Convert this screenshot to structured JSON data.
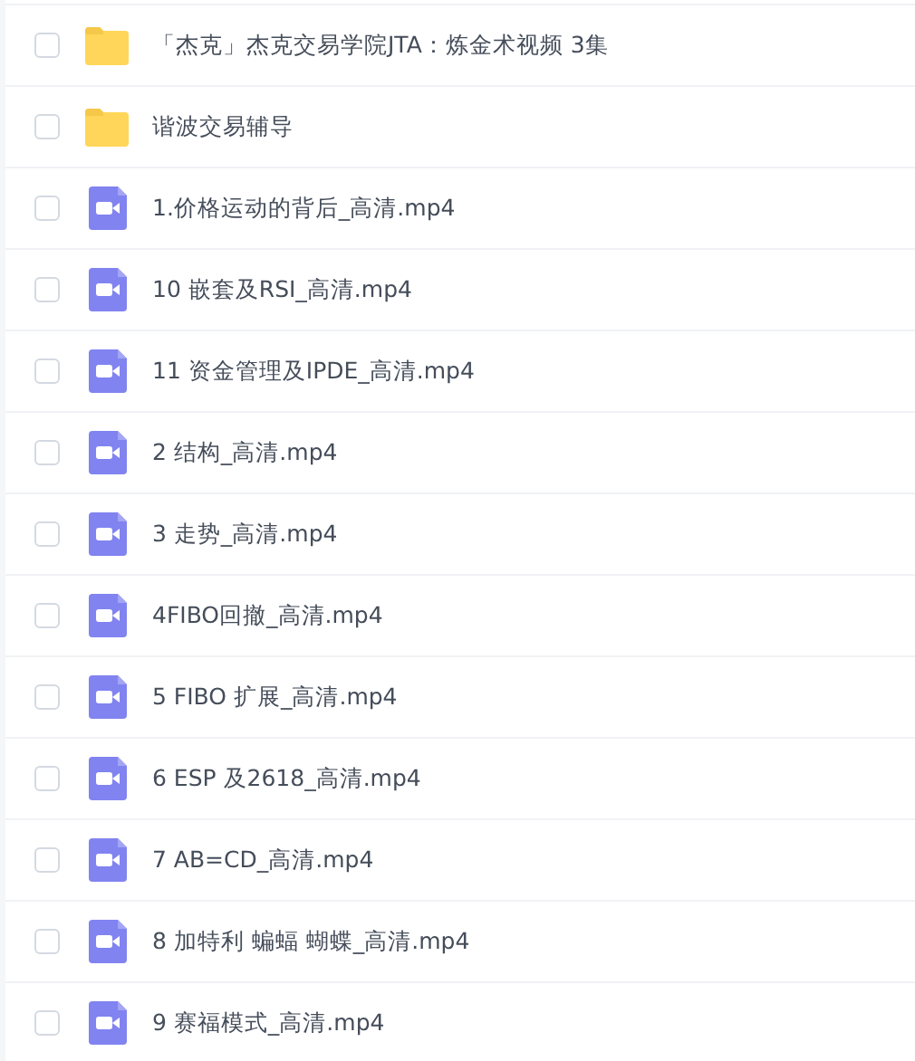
{
  "files": [
    {
      "kind": "folder",
      "name": "「杰克」杰克交易学院JTA：炼金术视频 3集",
      "checked": false
    },
    {
      "kind": "folder",
      "name": "谐波交易辅导",
      "checked": false
    },
    {
      "kind": "video",
      "name": "1.价格运动的背后_高清.mp4",
      "checked": false
    },
    {
      "kind": "video",
      "name": "10 嵌套及RSI_高清.mp4",
      "checked": false
    },
    {
      "kind": "video",
      "name": "11 资金管理及IPDE_高清.mp4",
      "checked": false
    },
    {
      "kind": "video",
      "name": "2 结构_高清.mp4",
      "checked": false
    },
    {
      "kind": "video",
      "name": "3 走势_高清.mp4",
      "checked": false
    },
    {
      "kind": "video",
      "name": "4FIBO回撤_高清.mp4",
      "checked": false
    },
    {
      "kind": "video",
      "name": "5 FIBO 扩展_高清.mp4",
      "checked": false
    },
    {
      "kind": "video",
      "name": "6 ESP 及2618_高清.mp4",
      "checked": false
    },
    {
      "kind": "video",
      "name": "7 AB=CD_高清.mp4",
      "checked": false
    },
    {
      "kind": "video",
      "name": "8 加特利 蝙蝠 蝴蝶_高清.mp4",
      "checked": false
    },
    {
      "kind": "video",
      "name": "9 赛福模式_高清.mp4",
      "checked": false
    }
  ]
}
